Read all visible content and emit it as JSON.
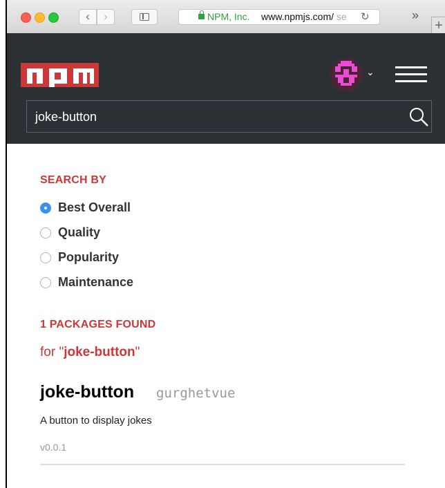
{
  "browser": {
    "url_cert": "NPM, Inc.",
    "url_host": "www.npmjs.com/",
    "url_fade": "se",
    "more_label": "»",
    "newtab_label": "+",
    "back_label": "‹",
    "forward_label": "›",
    "reload_label": "↻"
  },
  "header": {
    "search_value": "joke-button",
    "avatar_caret": "⌄"
  },
  "search_by": {
    "title": "SEARCH BY",
    "options": [
      {
        "label": "Best Overall",
        "selected": true
      },
      {
        "label": "Quality",
        "selected": false
      },
      {
        "label": "Popularity",
        "selected": false
      },
      {
        "label": "Maintenance",
        "selected": false
      }
    ]
  },
  "results": {
    "count_label": "1 PACKAGES FOUND",
    "for_prefix": "for \"",
    "query": "joke-button",
    "for_suffix": "\""
  },
  "package": {
    "name": "joke-button",
    "author": "gurghetvue",
    "description": "A button to display jokes",
    "version": "v0.0.1"
  },
  "colors": {
    "npm_red": "#cb3837",
    "header_bg": "#2b3034",
    "radio_selected": "#3c8ff0"
  }
}
